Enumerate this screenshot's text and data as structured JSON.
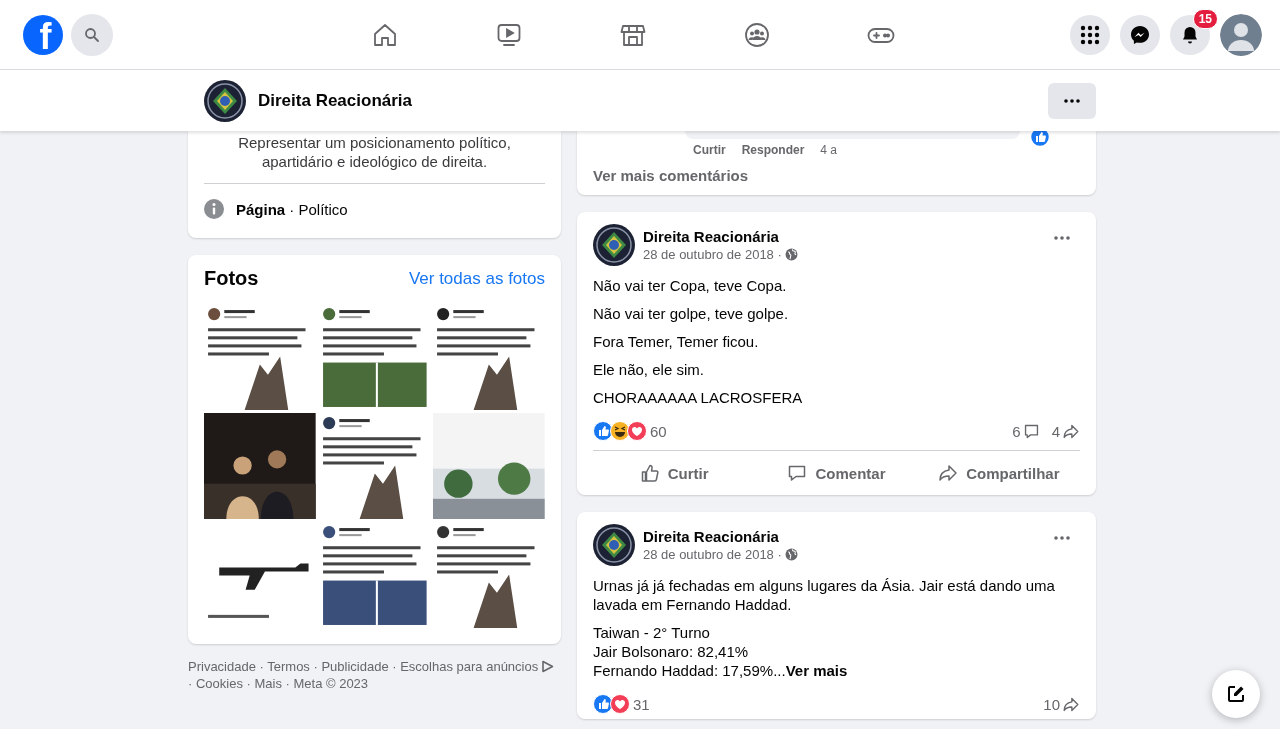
{
  "top_nav": {
    "logo_letter": "f",
    "tabs": [
      {
        "kind": "home"
      },
      {
        "kind": "video"
      },
      {
        "kind": "marketplace"
      },
      {
        "kind": "groups"
      },
      {
        "kind": "gaming"
      }
    ],
    "actions": [
      {
        "kind": "menu"
      },
      {
        "kind": "messenger"
      },
      {
        "kind": "notifications",
        "badge": "15"
      }
    ]
  },
  "page_header": {
    "title": "Direita Reacionária"
  },
  "intro": {
    "description": "Representar um posicionamento político,\napartidário e ideológico de direita.",
    "category_label": "Página",
    "category": "· Político"
  },
  "photos": {
    "title": "Fotos",
    "link": "Ver todas as fotos"
  },
  "footer": {
    "text_before": "Privacidade · Termos · Publicidade · Escolhas para anúncios",
    "text_after": "· Cookies · Mais · Meta © 2023"
  },
  "posts": [
    {
      "kind": "comment_tail",
      "comment_actions": [
        "Curtir",
        "Responder"
      ],
      "comment_time": "4 a",
      "comment_reactions": [
        {
          "kind": "like"
        }
      ],
      "more_comments": "Ver mais comentários"
    },
    {
      "kind": "post",
      "author": "Direita Reacionária",
      "date": "28 de outubro de 2018 ·",
      "paragraphs": [
        "Não vai ter Copa, teve Copa.",
        "Não vai ter golpe, teve golpe.",
        "Fora Temer, Temer ficou.",
        "Ele não, ele sim.",
        "CHORAAAAAA LACROSFERA"
      ],
      "reactions": [
        {
          "kind": "like"
        },
        {
          "kind": "haha"
        },
        {
          "kind": "love"
        }
      ],
      "reaction_count": "60",
      "comments_count": "6",
      "shares_count": "4",
      "actions": [
        "Curtir",
        "Comentar",
        "Compartilhar"
      ]
    },
    {
      "kind": "post",
      "author": "Direita Reacionária",
      "date": "28 de outubro de 2018 ·",
      "paragraphs": [
        "Urnas já já fechadas em alguns lugares da Ásia. Jair está dando uma lavada em Fernando Haddad.",
        "Taiwan - 2° Turno\nJair Bolsonaro: 82,41%\nFernando Haddad: 17,59%..."
      ],
      "see_more": "Ver mais",
      "reactions": [
        {
          "kind": "like"
        },
        {
          "kind": "love"
        }
      ],
      "reaction_count": "31",
      "shares_count": "10"
    }
  ]
}
